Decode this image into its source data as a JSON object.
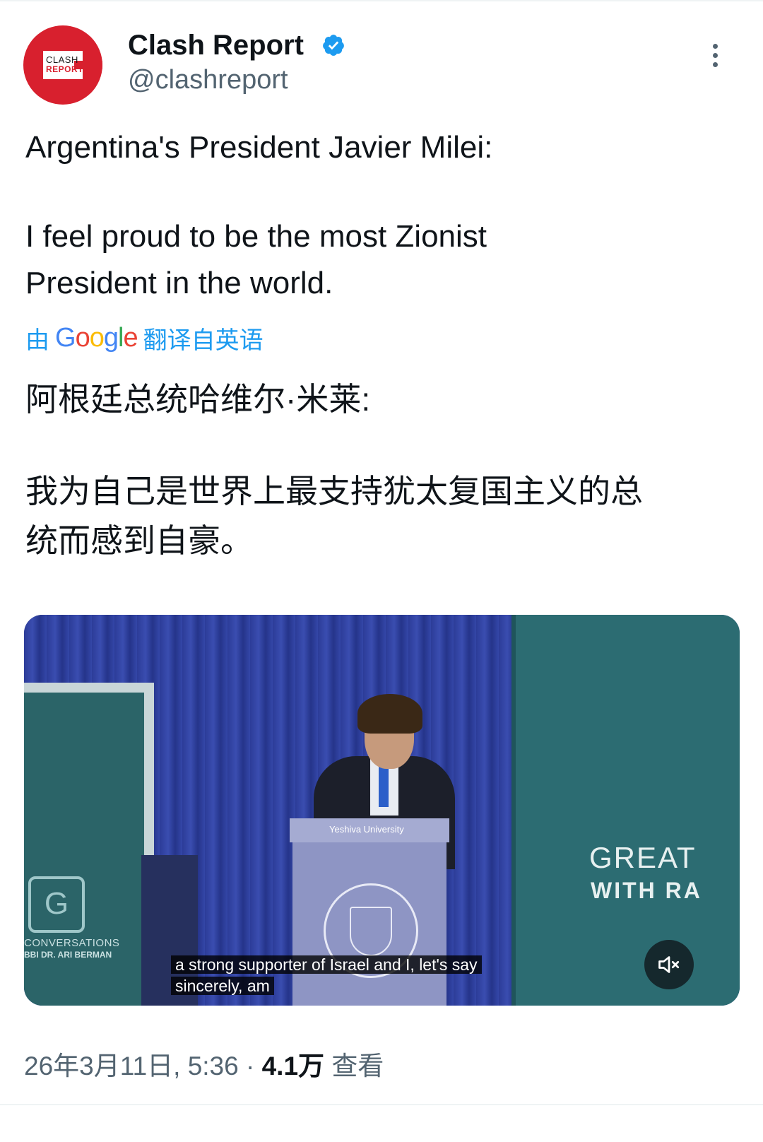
{
  "author": {
    "name": "Clash Report",
    "handle": "@clashreport",
    "avatar_text_top": "CLASH",
    "avatar_text_bottom": "REPORT",
    "verified": true
  },
  "tweet": {
    "text_en": {
      "line1": "Argentina's President Javier Milei:",
      "line2": "I feel proud to be the most Zionist",
      "line3": "President in the world."
    },
    "translation": {
      "prefix": "由",
      "provider": "Google",
      "suffix": "翻译自英语"
    },
    "text_zh": {
      "line1": "阿根廷总统哈维尔·米莱:",
      "line2": "我为自己是世界上最支持犹太复国主义的总",
      "line3": "统而感到自豪。"
    }
  },
  "video": {
    "caption_line1": "a strong supporter of Israel and I, let's say",
    "caption_line2": "sincerely, am",
    "podium_label": "Yeshiva University",
    "banner_line1": "GREAT",
    "banner_line2": "WITH RA",
    "left_banner_line1": "CONVERSATIONS",
    "left_banner_line2": "BBI DR. ARI BERMAN",
    "muted": true
  },
  "meta": {
    "date": "26年3月11日, 5:36",
    "separator": "·",
    "views_count": "4.1万",
    "views_label": "查看"
  },
  "colors": {
    "accent": "#1d9bf0",
    "avatar": "#d8202e",
    "secondary_text": "#536471"
  }
}
